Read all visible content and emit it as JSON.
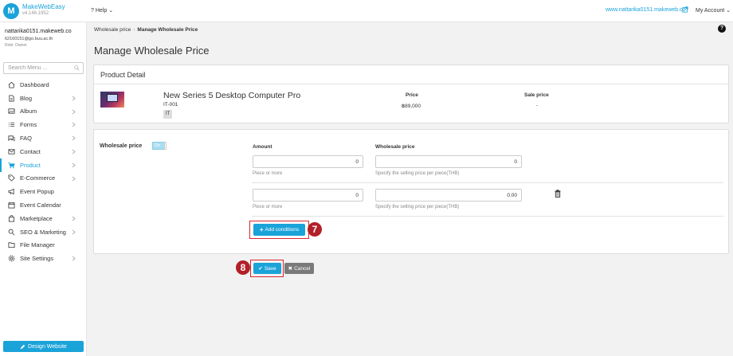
{
  "topbar": {
    "logo_name": "MakeWebEasy",
    "logo_version": "v4.146.1952",
    "help_label": "Help",
    "site_url": "www.nattarika0151.makeweb.co",
    "account_label": "My Account"
  },
  "sidebar": {
    "user_name": "nattarika0151.makeweb.co",
    "user_email": "62160151@go.buu.ac.th",
    "user_role": "Role: Owner",
    "search_placeholder": "Search Menu ...",
    "items": [
      {
        "label": "Dashboard",
        "icon": "home-icon",
        "chevron": false,
        "active": false
      },
      {
        "label": "Blog",
        "icon": "document-icon",
        "chevron": true,
        "active": false
      },
      {
        "label": "Album",
        "icon": "image-icon",
        "chevron": true,
        "active": false
      },
      {
        "label": "Forms",
        "icon": "list-icon",
        "chevron": true,
        "active": false
      },
      {
        "label": "FAQ",
        "icon": "chat-icon",
        "chevron": true,
        "active": false
      },
      {
        "label": "Contact",
        "icon": "envelope-icon",
        "chevron": true,
        "active": false
      },
      {
        "label": "Product",
        "icon": "cart-icon",
        "chevron": true,
        "active": true
      },
      {
        "label": "E-Commerce",
        "icon": "tag-icon",
        "chevron": true,
        "active": false
      },
      {
        "label": "Event Popup",
        "icon": "megaphone-icon",
        "chevron": false,
        "active": false
      },
      {
        "label": "Event Calendar",
        "icon": "calendar-icon",
        "chevron": false,
        "active": false
      },
      {
        "label": "Marketplace",
        "icon": "bag-icon",
        "chevron": true,
        "active": false
      },
      {
        "label": "SEO & Marketing",
        "icon": "search-icon",
        "chevron": true,
        "active": false
      },
      {
        "label": "File Manager",
        "icon": "folder-icon",
        "chevron": false,
        "active": false
      },
      {
        "label": "Site Settings",
        "icon": "gear-icon",
        "chevron": true,
        "active": false
      }
    ],
    "design_button_label": "Design Website"
  },
  "breadcrumb": {
    "parent": "Wholesale price",
    "current": "Manage Wholesale Price"
  },
  "page_title": "Manage Wholesale Price",
  "product_detail": {
    "heading": "Product Detail",
    "name": "New Series 5 Desktop Computer Pro",
    "sku": "IT-001",
    "category_badge": "IT",
    "price_label": "Price",
    "price_value": "฿89,000",
    "sale_price_label": "Sale price",
    "sale_price_value": "-"
  },
  "wholesale": {
    "label": "Wholesale price",
    "toggle_label": "On",
    "amount_header": "Amount",
    "price_header": "Wholesale price",
    "rows": [
      {
        "amount": "0",
        "amount_hint": "Piece or more",
        "price": "0",
        "price_hint": "Specify the selling price per piece(THB)"
      },
      {
        "amount": "0",
        "amount_hint": "Piece or more",
        "price": "0.00",
        "price_hint": "Specify the selling price per piece(THB)"
      }
    ],
    "add_button_label": "Add conditions"
  },
  "annotations": {
    "step_add": "7",
    "step_save": "8"
  },
  "actions": {
    "save_label": "Save",
    "cancel_label": "Cancel"
  },
  "colors": {
    "accent": "#1aa3d9",
    "highlight": "#d9272e",
    "badge": "#b22028"
  }
}
